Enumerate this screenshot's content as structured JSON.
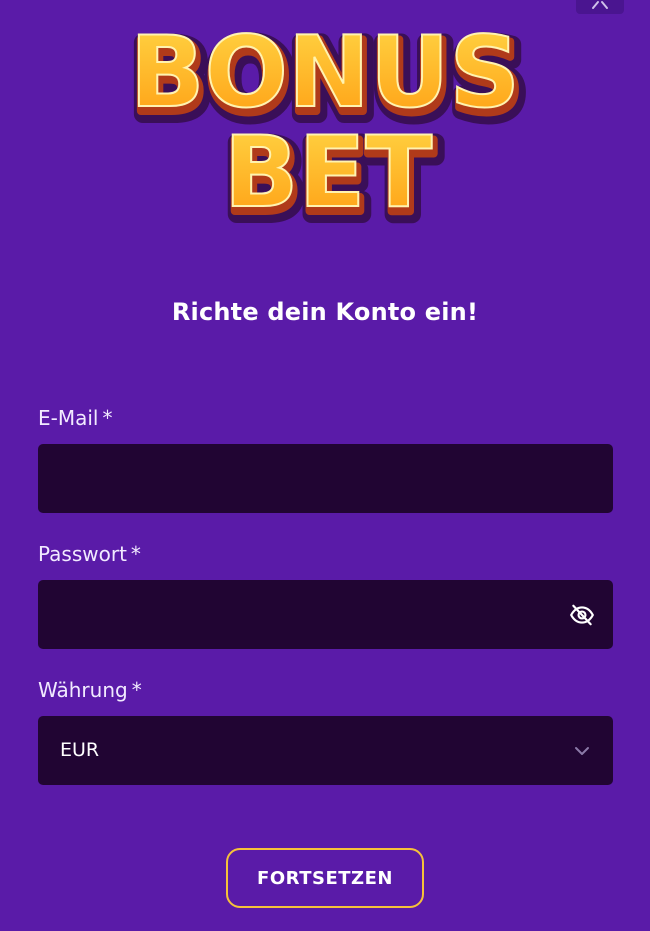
{
  "brand": {
    "logo_line1": "BONUS",
    "logo_line2": "BET",
    "logo_fill": "#ffc21c",
    "logo_shadow": "#b03a1a",
    "logo_accent": "#c04fe0"
  },
  "form": {
    "title": "Richte dein Konto ein!",
    "email": {
      "label": "E-Mail",
      "required_mark": "*",
      "value": "",
      "placeholder": ""
    },
    "password": {
      "label": "Passwort",
      "required_mark": "*",
      "value": "",
      "placeholder": "",
      "toggle_icon": "eye-off-icon"
    },
    "currency": {
      "label": "Währung",
      "required_mark": "*",
      "selected": "EUR",
      "dropdown_icon": "chevron-down-icon"
    },
    "submit_label": "FORTSETZEN"
  },
  "colors": {
    "background": "#5a1ba8",
    "input_background": "#210533",
    "button_border": "#f6c23a"
  }
}
